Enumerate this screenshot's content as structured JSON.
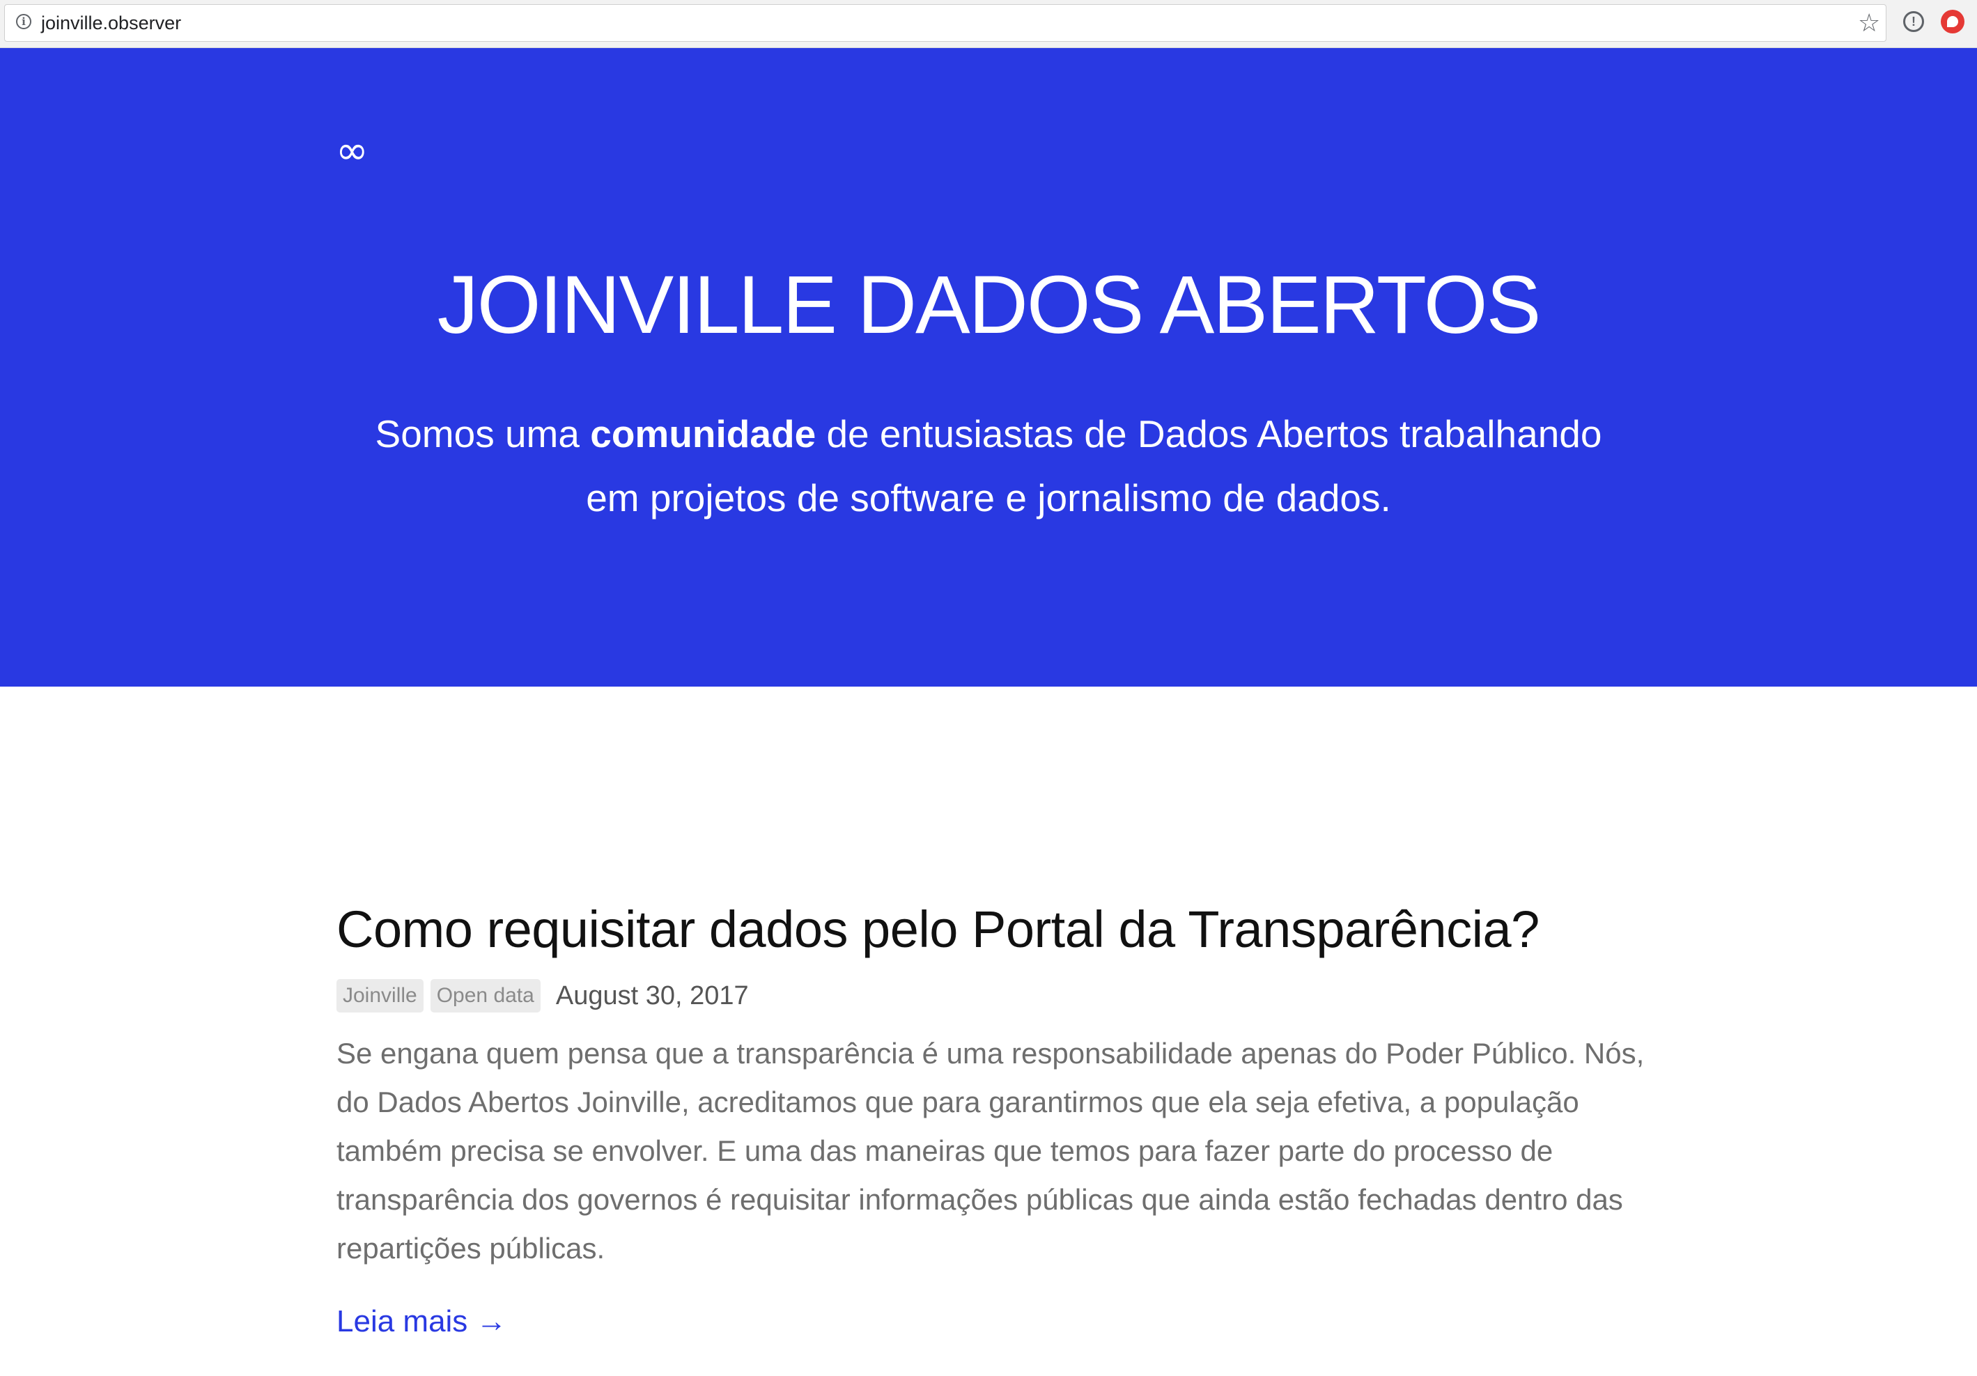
{
  "browser": {
    "url": "joinville.observer",
    "icons": {
      "site_info": "info-icon",
      "bookmark": "star-icon",
      "extension_1": "info-circle-icon",
      "extension_2": "red-extension-icon"
    }
  },
  "hero": {
    "logo": "∞",
    "title": "JOINVILLE DADOS ABERTOS",
    "subtitle_part1": "Somos uma ",
    "subtitle_bold": "comunidade",
    "subtitle_part2": " de entusiastas de Dados Abertos trabalhando em projetos de software e jornalismo de dados.",
    "background_color": "#2939e2"
  },
  "post": {
    "title": "Como requisitar dados pelo Portal da Transparência?",
    "tags": [
      "Joinville",
      "Open data"
    ],
    "date": "August 30, 2017",
    "excerpt": "Se engana quem pensa que a transparência é uma responsabilidade apenas do Poder Público. Nós, do Dados Abertos Joinville, acreditamos que para garantirmos que ela seja efetiva, a população também precisa se envolver. E uma das maneiras que temos para fazer parte do processo de transparência dos governos é requisitar informações públicas que ainda estão fechadas dentro das repartições públicas.",
    "read_more": "Leia mais →",
    "link_color": "#2939e2"
  }
}
